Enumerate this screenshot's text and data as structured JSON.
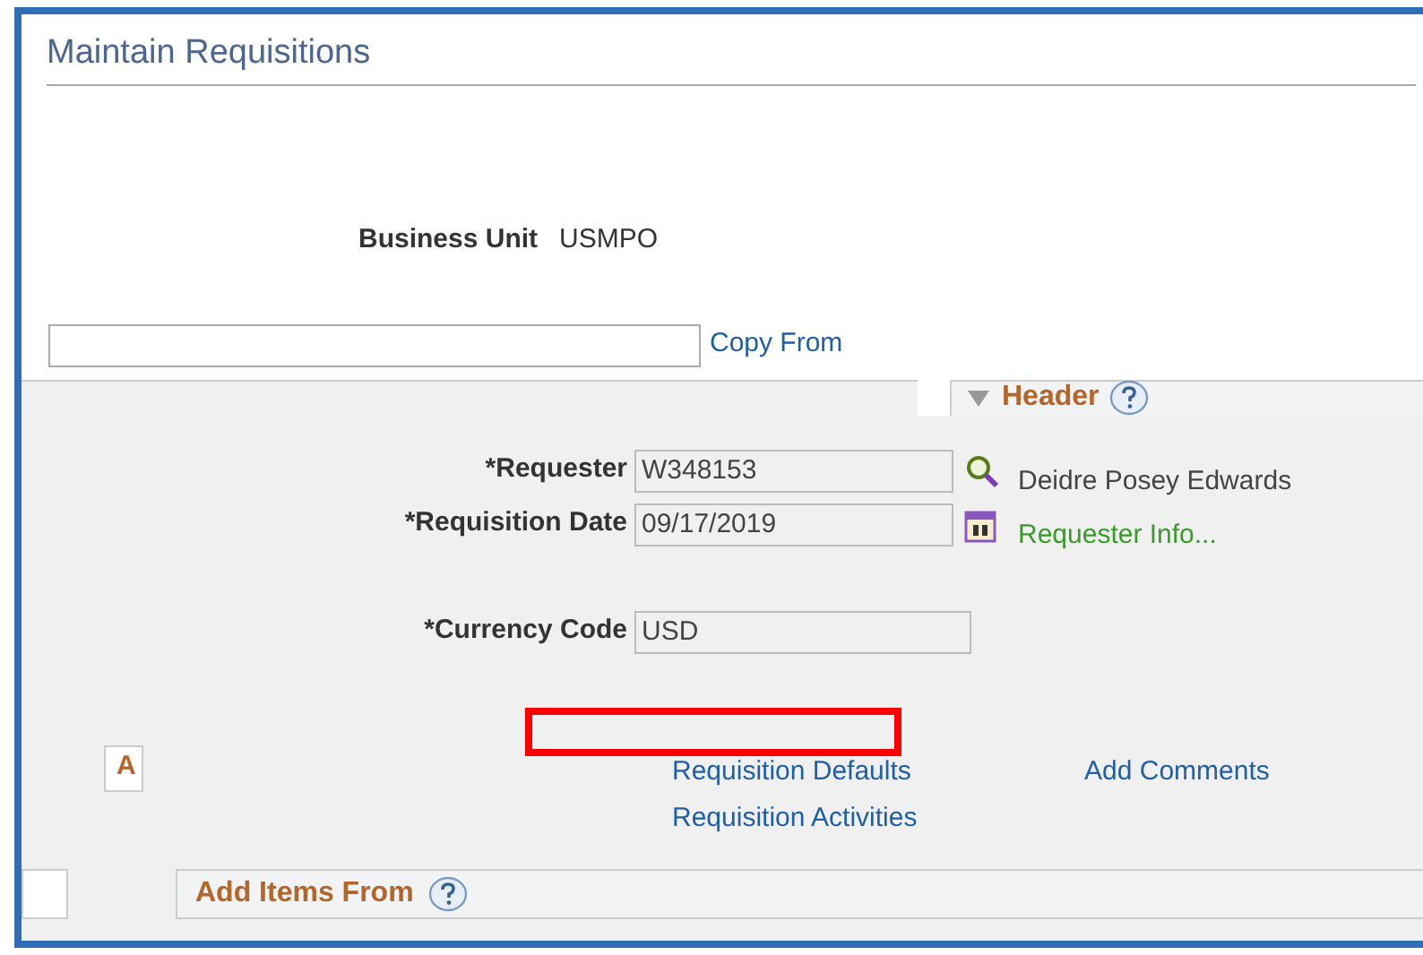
{
  "window": {
    "title": "Maintain Requisitions"
  },
  "business_unit": {
    "label": "Business Unit",
    "value": "USMPO"
  },
  "copy_from": {
    "link": "Copy From"
  },
  "header_panel": {
    "title": "Header",
    "expanded": true
  },
  "fields": [
    {
      "kind": "lookup",
      "label": "*Requester",
      "value": "W348153",
      "aside": "Deidre Posey Edwards"
    },
    {
      "kind": "date",
      "label": "*Requisition Date",
      "value": "09/17/2019",
      "aside": "Requester Info..."
    },
    {
      "kind": "plain",
      "label": "*Currency Code",
      "value": "USD"
    }
  ],
  "tab_fragment": "A",
  "highlight_box": true,
  "links": [
    {
      "label": "Requisition Defaults"
    },
    {
      "label": "Add Comments"
    },
    {
      "label": "Requisition Activities"
    }
  ],
  "add_items": {
    "title": "Add Items From"
  }
}
